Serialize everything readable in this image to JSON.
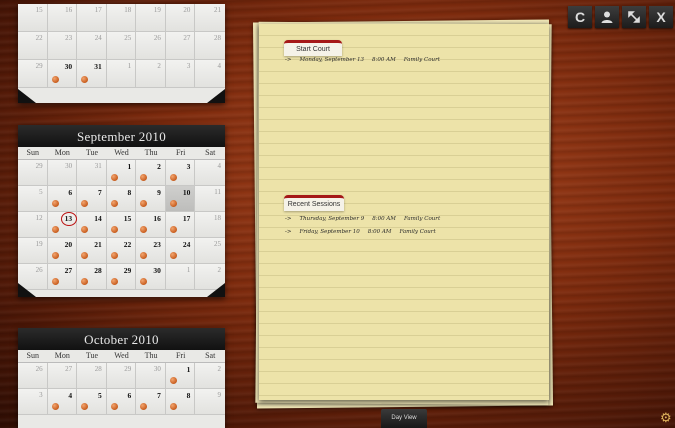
{
  "calendars": [
    {
      "title": "",
      "dow": [],
      "weeks": [
        [
          {
            "d": "15"
          },
          {
            "d": "16"
          },
          {
            "d": "17"
          },
          {
            "d": "18"
          },
          {
            "d": "19"
          },
          {
            "d": "20"
          },
          {
            "d": "21"
          }
        ],
        [
          {
            "d": "22"
          },
          {
            "d": "23"
          },
          {
            "d": "24"
          },
          {
            "d": "25"
          },
          {
            "d": "26"
          },
          {
            "d": "27"
          },
          {
            "d": "28"
          }
        ],
        [
          {
            "d": "29"
          },
          {
            "d": "30",
            "cur": true,
            "dot": true
          },
          {
            "d": "31",
            "cur": true,
            "dot": true
          },
          {
            "d": "1"
          },
          {
            "d": "2"
          },
          {
            "d": "3"
          },
          {
            "d": "4"
          }
        ]
      ]
    },
    {
      "title": "September 2010",
      "dow": [
        "Sun",
        "Mon",
        "Tue",
        "Wed",
        "Thu",
        "Fri",
        "Sat"
      ],
      "weeks": [
        [
          {
            "d": "29"
          },
          {
            "d": "30"
          },
          {
            "d": "31"
          },
          {
            "d": "1",
            "cur": true,
            "dot": true
          },
          {
            "d": "2",
            "cur": true,
            "dot": true
          },
          {
            "d": "3",
            "cur": true,
            "dot": true
          },
          {
            "d": "4"
          }
        ],
        [
          {
            "d": "5"
          },
          {
            "d": "6",
            "cur": true,
            "dot": true
          },
          {
            "d": "7",
            "cur": true,
            "dot": true
          },
          {
            "d": "8",
            "cur": true,
            "dot": true
          },
          {
            "d": "9",
            "cur": true,
            "dot": true
          },
          {
            "d": "10",
            "cur": true,
            "dot": true,
            "today": true
          },
          {
            "d": "11"
          }
        ],
        [
          {
            "d": "12"
          },
          {
            "d": "13",
            "cur": true,
            "dot": true,
            "circled": true
          },
          {
            "d": "14",
            "cur": true,
            "dot": true
          },
          {
            "d": "15",
            "cur": true,
            "dot": true
          },
          {
            "d": "16",
            "cur": true,
            "dot": true
          },
          {
            "d": "17",
            "cur": true,
            "dot": true
          },
          {
            "d": "18"
          }
        ],
        [
          {
            "d": "19"
          },
          {
            "d": "20",
            "cur": true,
            "dot": true
          },
          {
            "d": "21",
            "cur": true,
            "dot": true
          },
          {
            "d": "22",
            "cur": true,
            "dot": true
          },
          {
            "d": "23",
            "cur": true,
            "dot": true
          },
          {
            "d": "24",
            "cur": true,
            "dot": true
          },
          {
            "d": "25"
          }
        ],
        [
          {
            "d": "26"
          },
          {
            "d": "27",
            "cur": true,
            "dot": true
          },
          {
            "d": "28",
            "cur": true,
            "dot": true
          },
          {
            "d": "29",
            "cur": true,
            "dot": true
          },
          {
            "d": "30",
            "cur": true,
            "dot": true
          },
          {
            "d": "1"
          },
          {
            "d": "2"
          }
        ]
      ]
    },
    {
      "title": "October 2010",
      "dow": [
        "Sun",
        "Mon",
        "Tue",
        "Wed",
        "Thu",
        "Fri",
        "Sat"
      ],
      "weeks": [
        [
          {
            "d": "26"
          },
          {
            "d": "27"
          },
          {
            "d": "28"
          },
          {
            "d": "29"
          },
          {
            "d": "30"
          },
          {
            "d": "1",
            "cur": true,
            "dot": true
          },
          {
            "d": "2"
          }
        ],
        [
          {
            "d": "3"
          },
          {
            "d": "4",
            "cur": true,
            "dot": true
          },
          {
            "d": "5",
            "cur": true,
            "dot": true
          },
          {
            "d": "6",
            "cur": true,
            "dot": true
          },
          {
            "d": "7",
            "cur": true,
            "dot": true
          },
          {
            "d": "8",
            "cur": true,
            "dot": true
          },
          {
            "d": "9"
          }
        ]
      ]
    }
  ],
  "notepad": {
    "start_court": {
      "label": "Start Court",
      "entries": [
        {
          "arrow": "->",
          "date": "Monday, September 13",
          "time": "8:00 AM",
          "court": "Family Court"
        }
      ]
    },
    "recent_sessions": {
      "label": "Recent Sessions",
      "entries": [
        {
          "arrow": "->",
          "date": "Thursday, September 9",
          "time": "8:00 AM",
          "court": "Family Court"
        },
        {
          "arrow": "->",
          "date": "Friday, September 10",
          "time": "8:00 AM",
          "court": "Family Court"
        }
      ]
    }
  },
  "toolbar": {
    "refresh_glyph": "C",
    "close_glyph": "X"
  },
  "day_view_label": "Day View",
  "colors": {
    "accent_red": "#a51818",
    "dot_orange": "#c85d1e",
    "paper": "#ede3a9"
  }
}
